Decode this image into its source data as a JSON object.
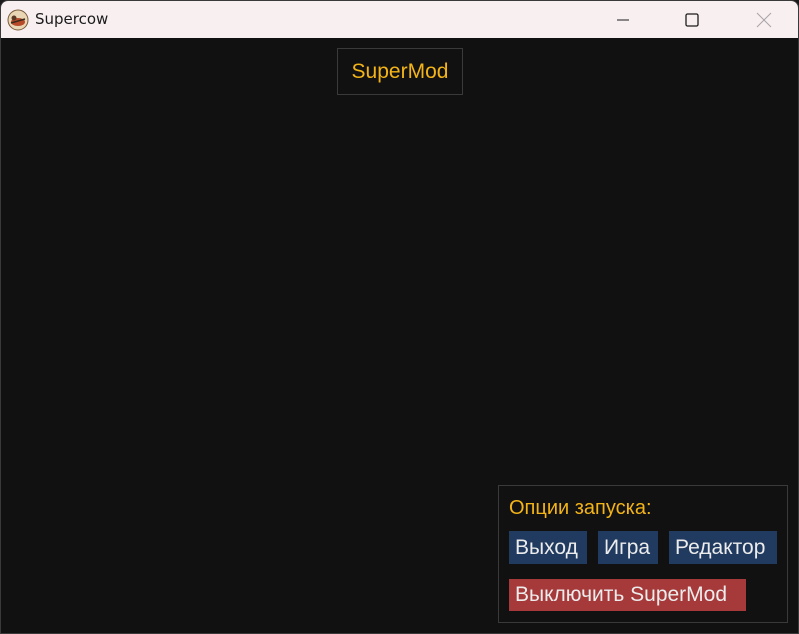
{
  "window": {
    "title": "Supercow",
    "icon": "supercow-app-icon",
    "controls": [
      "minimize-icon",
      "maximize-icon",
      "close-icon"
    ]
  },
  "brand": {
    "label": "SuperMod"
  },
  "launch_panel": {
    "title": "Опции запуска:",
    "buttons": {
      "exit": "Выход",
      "game": "Игра",
      "editor": "Редактор",
      "disable": "Выключить SuperMod"
    }
  },
  "colors": {
    "background": "#121112",
    "accent": "#f3b418",
    "button_blue": "#203a60",
    "button_red": "#a63a3a",
    "titlebar": "#f8eff1"
  }
}
